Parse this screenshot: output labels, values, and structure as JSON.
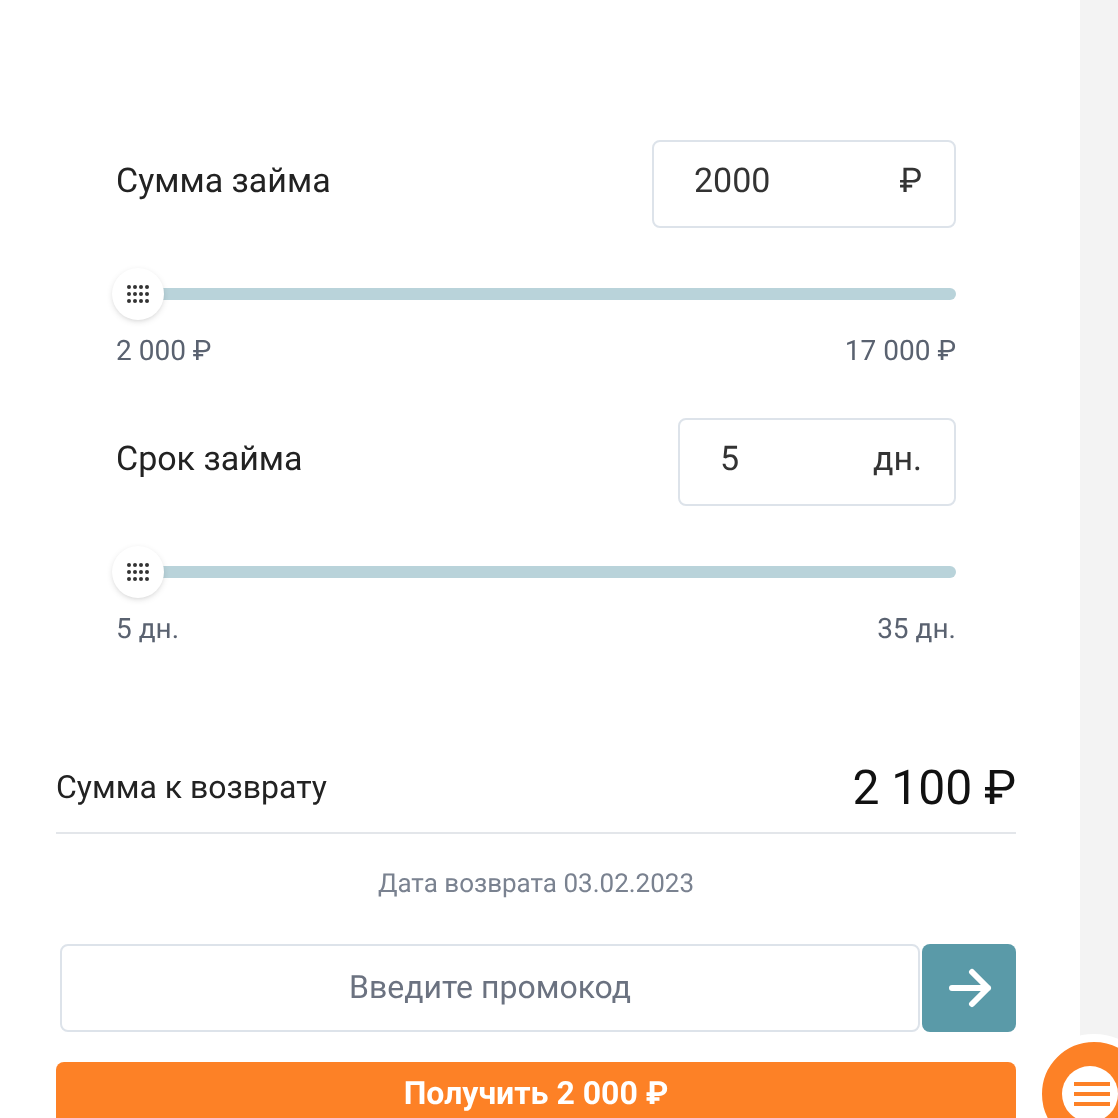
{
  "sliders": [
    {
      "label": "Сумма займа",
      "value": "2000",
      "unit": "₽",
      "level": 0,
      "min": "2 000 ₽",
      "max": "17 000 ₽"
    },
    {
      "label": "Срок займа",
      "value": "5",
      "unit": "дн.",
      "level": 0,
      "min": "5 дн.",
      "max": "35 дн."
    }
  ],
  "total": {
    "label": "Сумма к возврату",
    "value": "2 100 ₽"
  },
  "return_date": "Дата возврата 03.02.2023",
  "promo": {
    "placeholder": "Введите промокод"
  },
  "submit": "Получить 2 000 ₽"
}
